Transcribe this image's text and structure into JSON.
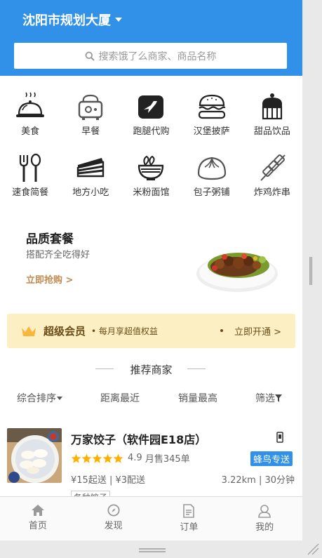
{
  "header": {
    "location": "沈阳市规划大厦",
    "search_placeholder": "搜索饿了么商家、商品名称"
  },
  "categories": [
    {
      "label": "美食",
      "icon": "cloche-icon"
    },
    {
      "label": "早餐",
      "icon": "toaster-icon"
    },
    {
      "label": "跑腿代购",
      "icon": "bird-app-icon"
    },
    {
      "label": "汉堡披萨",
      "icon": "burger-icon"
    },
    {
      "label": "甜品饮品",
      "icon": "cake-icon"
    },
    {
      "label": "速食简餐",
      "icon": "fork-spoon-icon"
    },
    {
      "label": "地方小吃",
      "icon": "cake-slice-icon"
    },
    {
      "label": "米粉面馆",
      "icon": "noodle-bowl-icon"
    },
    {
      "label": "包子粥铺",
      "icon": "dumpling-icon"
    },
    {
      "label": "炸鸡炸串",
      "icon": "skewer-icon"
    }
  ],
  "promo": {
    "title": "品质套餐",
    "subtitle": "搭配齐全吃得好",
    "link": "立即抢购 >"
  },
  "vip": {
    "title": "超级会员",
    "subtitle": "• 每月享超值权益",
    "action": "立即开通 >"
  },
  "recommend": {
    "title": "推荐商家"
  },
  "sort": {
    "items": [
      "综合排序",
      "距离最近",
      "销量最高",
      "筛选"
    ]
  },
  "store": {
    "name": "万家饺子（软件园E18店）",
    "rating": "4.9",
    "stars": 5,
    "monthly_sales": "月售345单",
    "delivery_badge": "蜂鸟专送",
    "fees": "¥15起送 | ¥3配送",
    "distance_time": "3.22km | 30分钟",
    "tag": "各种饺子"
  },
  "bottom_nav": [
    {
      "label": "首页",
      "icon": "home-icon"
    },
    {
      "label": "发现",
      "icon": "compass-icon"
    },
    {
      "label": "订单",
      "icon": "order-icon"
    },
    {
      "label": "我的",
      "icon": "user-icon"
    }
  ],
  "colors": {
    "brand": "#3190e8",
    "vip_bg": "#fcefc3",
    "promo_link": "#c08b52",
    "star": "#ffb000"
  }
}
